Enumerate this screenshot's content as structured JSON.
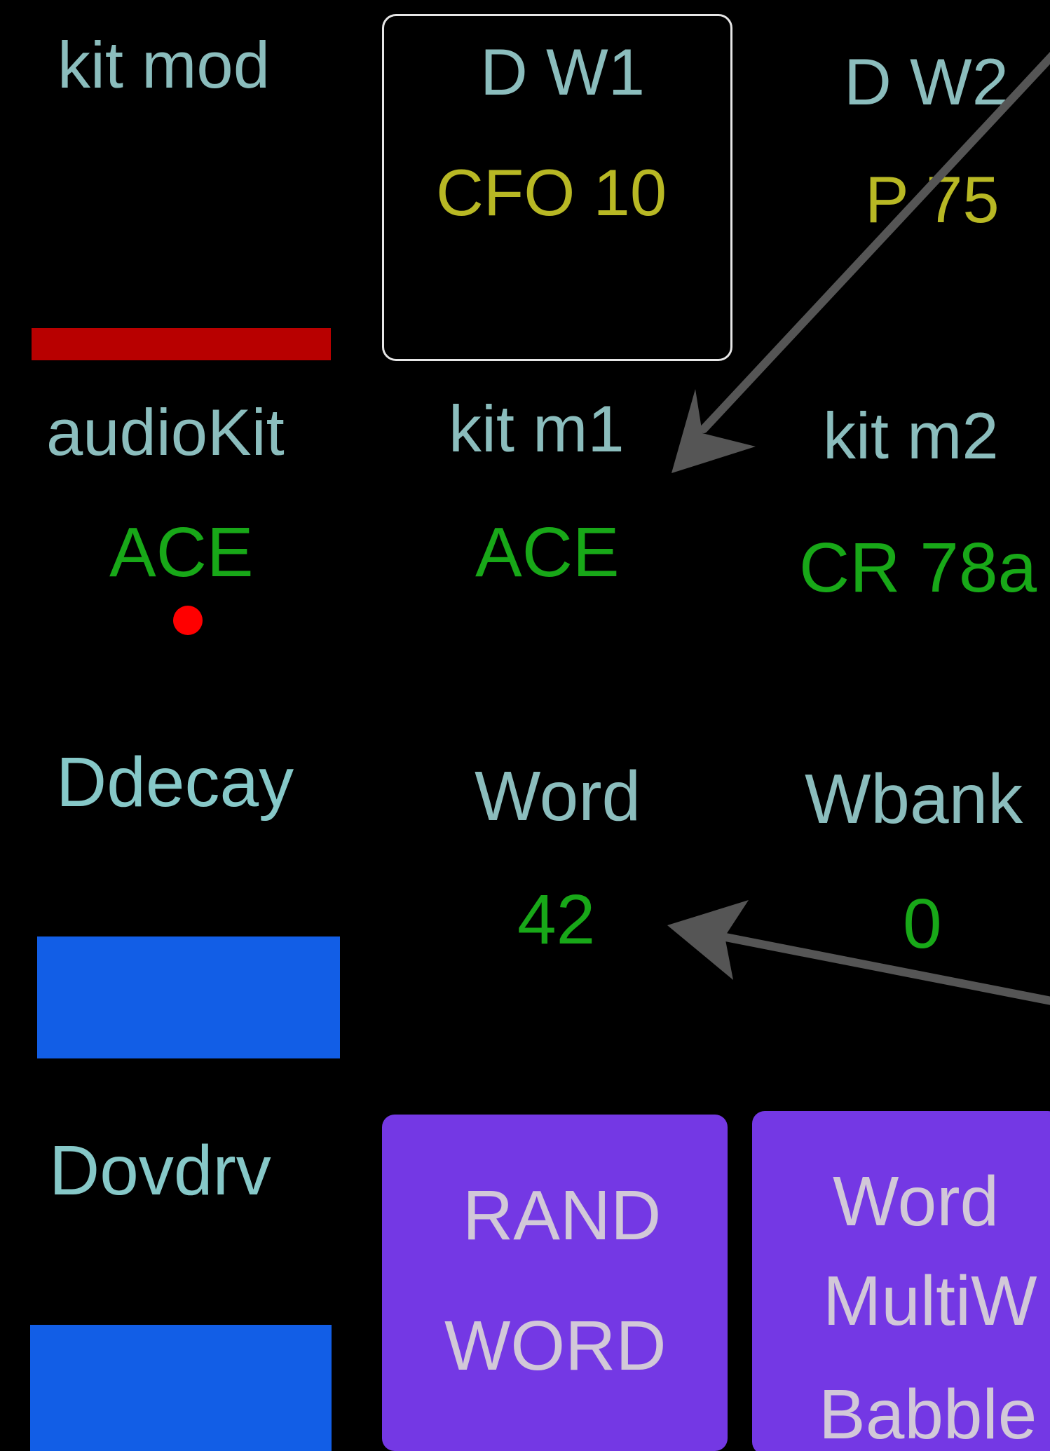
{
  "cells": {
    "kit_mod": {
      "label": "kit mod",
      "bar_color": "#b80000"
    },
    "dw1": {
      "label": "D W1",
      "value": "CFO 10",
      "selected": true
    },
    "dw2": {
      "label": "D W2",
      "value": "P 75"
    },
    "audiokit": {
      "label": "audioKit",
      "value": "ACE",
      "indicator_color": "#ff0000"
    },
    "kit_m1": {
      "label": "kit m1",
      "value": "ACE"
    },
    "kit_m2": {
      "label": "kit m2",
      "value": "CR 78a"
    },
    "ddecay": {
      "label": "Ddecay",
      "bar_color": "#125ee6"
    },
    "word": {
      "label": "Word",
      "value": "42"
    },
    "wbank": {
      "label": "Wbank",
      "value": "0"
    },
    "dovdrv": {
      "label": "Dovdrv",
      "bar_color": "#125ee6"
    }
  },
  "buttons": {
    "rand_word": {
      "line1": "RAND",
      "line2": "WORD",
      "color": "#7438e4"
    },
    "word_mode": {
      "line1": "Word",
      "line2": "MultiW",
      "line3": "Babble",
      "color": "#7438e4"
    }
  },
  "colors": {
    "background": "#000000",
    "label": "#8bbdbd",
    "value_yellow": "#b8b824",
    "value_green": "#18a818",
    "button_text": "#d2c8d8",
    "arrow": "#555555"
  }
}
